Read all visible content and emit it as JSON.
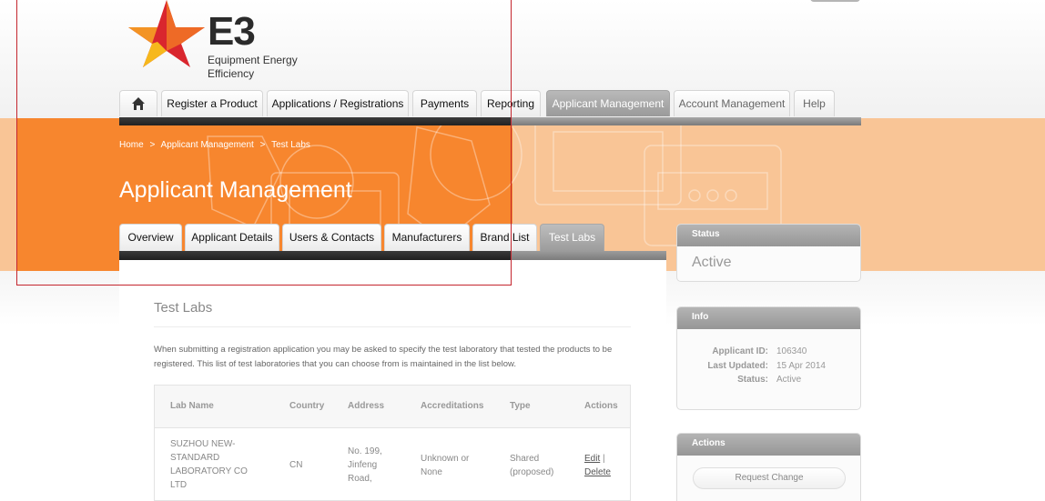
{
  "logo": {
    "word": "E3",
    "subtitle_line1": "Equipment Energy",
    "subtitle_line2": "Efficiency"
  },
  "nav": {
    "home_icon": "home-icon",
    "items": [
      {
        "label": "Register a Product"
      },
      {
        "label": "Applications / Registrations"
      },
      {
        "label": "Payments"
      },
      {
        "label": "Reporting"
      },
      {
        "label": "Applicant Management",
        "active": true
      },
      {
        "label": "Account Management"
      },
      {
        "label": "Help"
      }
    ]
  },
  "breadcrumb": {
    "items": [
      "Home",
      "Applicant Management",
      "Test Labs"
    ],
    "separator": ">"
  },
  "page_title": "Applicant Management",
  "subtabs": [
    {
      "label": "Overview"
    },
    {
      "label": "Applicant Details"
    },
    {
      "label": "Users & Contacts"
    },
    {
      "label": "Manufacturers"
    },
    {
      "label": "Brand List"
    },
    {
      "label": "Test Labs",
      "active": true
    }
  ],
  "content": {
    "heading": "Test Labs",
    "description": "When submitting a registration application you may be asked to specify the test laboratory that tested the products to be registered. This list of test laboratories that you can choose from is maintained in the list below.",
    "table": {
      "headers": [
        "Lab Name",
        "Country",
        "Address",
        "Accreditations",
        "Type",
        "Actions"
      ],
      "rows": [
        {
          "lab_name": [
            "SUZHOU NEW-",
            "STANDARD",
            "LABORATORY CO",
            "LTD"
          ],
          "country": "CN",
          "address": [
            "No. 199,",
            "Jinfeng",
            "Road,"
          ],
          "accreditations": [
            "Unknown or",
            "None"
          ],
          "type": [
            "Shared",
            "(proposed)"
          ],
          "edit": "Edit",
          "sep": "|",
          "delete": "Delete"
        }
      ]
    }
  },
  "sidebar": {
    "status": {
      "title": "Status",
      "value": "Active"
    },
    "info": {
      "title": "Info",
      "applicant_id_label": "Applicant ID:",
      "applicant_id": "106340",
      "last_updated_label": "Last Updated:",
      "last_updated": "15 Apr 2014",
      "status_label": "Status:",
      "status": "Active"
    },
    "actions": {
      "title": "Actions",
      "request_change": "Request Change"
    }
  },
  "colors": {
    "accent_orange": "#f7862e",
    "light_orange": "#f9c596",
    "active_tab_grey": "#9a9a9a",
    "star_red": "#d9262e",
    "star_yellow": "#f6b81c"
  }
}
